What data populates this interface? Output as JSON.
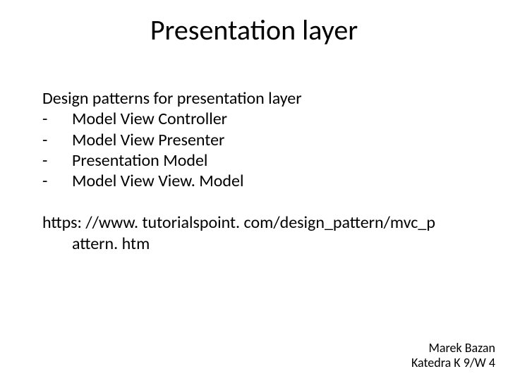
{
  "title": "Presentation layer",
  "intro": "Design patterns for presentation layer",
  "items": [
    "Model View Controller",
    "Model View Presenter",
    "Presentation Model",
    "Model View View. Model"
  ],
  "url_line1": "https: //www. tutorialspoint. com/design_pattern/mvc_p",
  "url_line2": "attern. htm",
  "footer_line1": "Marek Bazan",
  "footer_line2": "Katedra K 9/W 4"
}
